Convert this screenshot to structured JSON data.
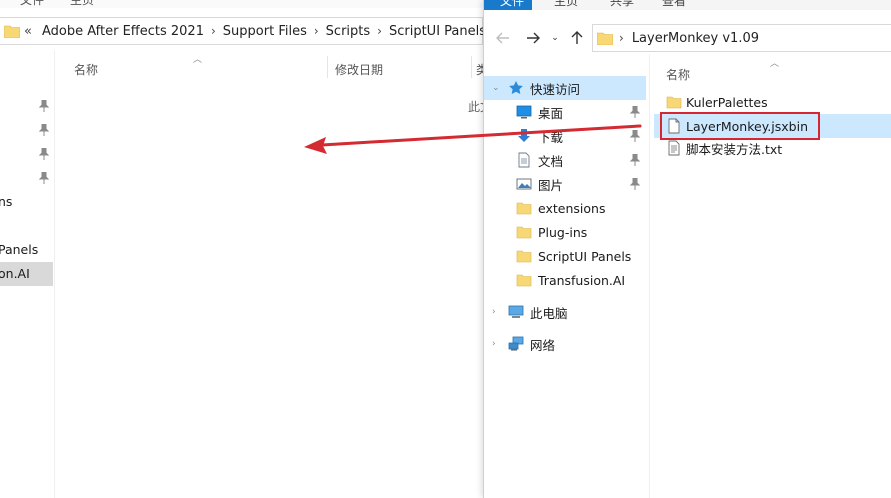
{
  "left_window": {
    "ribbon_tabs": [
      "文件",
      "主页"
    ],
    "breadcrumb_prefix": "«",
    "breadcrumb": [
      "Adobe After Effects 2021",
      "Support Files",
      "Scripts",
      "ScriptUI Panels"
    ],
    "columns": [
      "名称",
      "修改日期",
      "类"
    ],
    "empty_text": "此文件夹为空。",
    "nav_fragments": [
      "ns",
      "Panels",
      "on.AI"
    ]
  },
  "right_window": {
    "ribbon_tabs": [
      "文件",
      "主页",
      "共享",
      "查看"
    ],
    "address": "LayerMonkey v1.09",
    "column_name": "名称",
    "nav": {
      "quick_access": "快速访问",
      "items": [
        {
          "label": "桌面",
          "icon": "desktop-icon",
          "pinned": true
        },
        {
          "label": "下载",
          "icon": "download-icon",
          "pinned": true
        },
        {
          "label": "文档",
          "icon": "document-icon",
          "pinned": true
        },
        {
          "label": "图片",
          "icon": "pictures-icon",
          "pinned": true
        },
        {
          "label": "extensions",
          "icon": "folder-icon",
          "pinned": false
        },
        {
          "label": "Plug-ins",
          "icon": "folder-icon",
          "pinned": false
        },
        {
          "label": "ScriptUI Panels",
          "icon": "folder-icon",
          "pinned": false
        },
        {
          "label": "Transfusion.AI",
          "icon": "folder-icon",
          "pinned": false
        }
      ],
      "this_pc": "此电脑",
      "network": "网络"
    },
    "files": [
      {
        "name": "KulerPalettes",
        "icon": "folder-icon"
      },
      {
        "name": "LayerMonkey.jsxbin",
        "icon": "file-icon",
        "selected": true
      },
      {
        "name": "脚本安装方法.txt",
        "icon": "text-file-icon"
      }
    ]
  },
  "colors": {
    "selection": "#cce8ff",
    "highlight_box": "#d6262f",
    "arrow": "#d42a32",
    "folder": "#f8d775",
    "file_tab": "#1979ca"
  }
}
